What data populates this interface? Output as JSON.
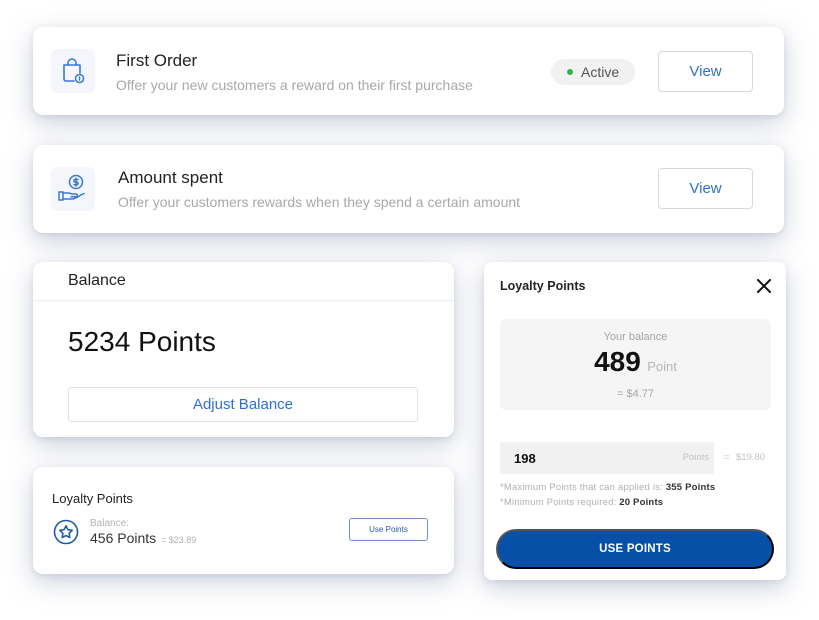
{
  "colors": {
    "accent": "#2f6fd1",
    "primary_button": "#0650a8",
    "status_active": "#2fb344"
  },
  "rules": [
    {
      "title": "First Order",
      "description": "Offer your new customers a reward on their first purchase",
      "icon": "shopping-bag-icon",
      "status": "Active",
      "view_label": "View"
    },
    {
      "title": "Amount spent",
      "description": "Offer your customers rewards when they spend a certain amount",
      "icon": "hand-coin-icon",
      "view_label": "View"
    }
  ],
  "balance_card": {
    "header": "Balance",
    "value": "5234 Points",
    "adjust_label": "Adjust Balance"
  },
  "loyalty_small": {
    "title": "Loyalty Points",
    "icon": "star-icon",
    "balance_label": "Balance:",
    "points": "456 Points",
    "money": "= $23.89",
    "button_label": "Use Points"
  },
  "loyalty_modal": {
    "title": "Loyalty Points",
    "close_icon": "close-icon",
    "balance_label": "Your balance",
    "balance_value": "489",
    "balance_unit": "Point",
    "balance_money": "= $4.77",
    "input_value": "198",
    "input_unit": "Points",
    "equals": "=",
    "input_money": "$19.80",
    "max_note_prefix": "*Maximum Points that can applied is: ",
    "max_note_value": "355 Points",
    "min_note_prefix": "*Minimum Points required: ",
    "min_note_value": "20 Points",
    "button_label": "USE POINTS"
  }
}
